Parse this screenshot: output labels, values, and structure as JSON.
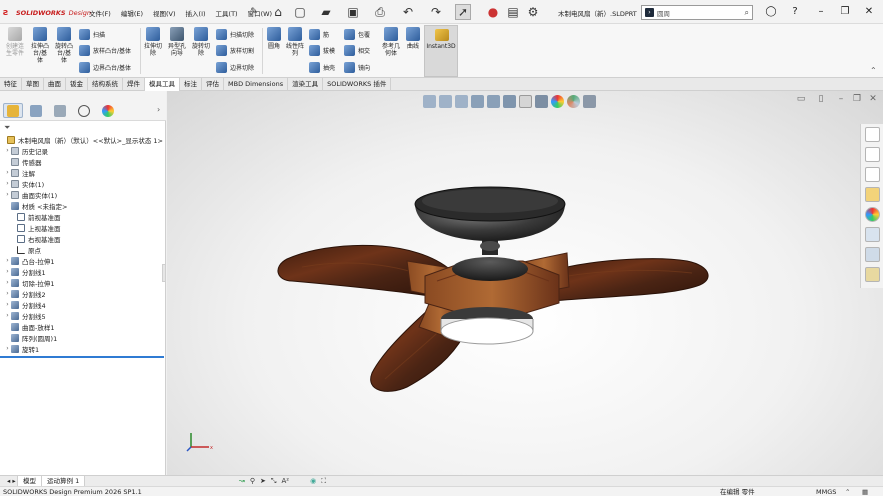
{
  "app": {
    "brand": "SOLIDWORKS",
    "brand_suffix": "Design",
    "doc_title": "木制电风扇（新）.SLDPRT",
    "search_text": "圆周"
  },
  "menu": [
    "文件(F)",
    "编辑(E)",
    "视图(V)",
    "插入(I)",
    "工具(T)",
    "窗口(W)"
  ],
  "ribbon": {
    "create_block": "创建连\n生零件",
    "extrude_boss": "拉伸凸\n台/基\n体",
    "revolve_boss": "旋转凸\n台/基\n体",
    "sweep": "扫描",
    "loft_boss": "放样凸台/基体",
    "boundary_boss": "边界凸台/基体",
    "extrude_cut": "拉伸切\n除",
    "hole_wizard": "异型孔\n向导",
    "revolve_cut": "旋转切\n除",
    "swept_cut": "扫描切除",
    "lofted_cut": "放样切割",
    "boundary_cut": "边界切除",
    "fillet": "圆角",
    "linear_pattern": "线性阵\n列",
    "rib": "筋",
    "draft": "拔模",
    "shell": "抽壳",
    "wrap": "包覆",
    "intersect": "相交",
    "mirror": "镜向",
    "ref_geometry": "参考几\n何体",
    "curves": "曲线",
    "instant3d": "Instant3D"
  },
  "tabs": [
    "特征",
    "草图",
    "曲面",
    "钣金",
    "结构系统",
    "焊件",
    "模具工具",
    "标注",
    "评估",
    "MBD Dimensions",
    "渲染工具",
    "SOLIDWORKS 插件"
  ],
  "active_tab": "模具工具",
  "tree": [
    {
      "label": "木制电风扇（新）（默认）<<默认>_显示状态 1>",
      "icon": "part",
      "exp": ""
    },
    {
      "label": "历史记录",
      "icon": "folder",
      "exp": "›"
    },
    {
      "label": "传感器",
      "icon": "folder",
      "exp": ""
    },
    {
      "label": "注解",
      "icon": "folder",
      "exp": "›"
    },
    {
      "label": "实体(1)",
      "icon": "folder",
      "exp": "›"
    },
    {
      "label": "曲面实体(1)",
      "icon": "folder",
      "exp": "›"
    },
    {
      "label": "材质 <未指定>",
      "icon": "material",
      "exp": ""
    },
    {
      "label": "前视基准面",
      "icon": "plane",
      "exp": ""
    },
    {
      "label": "上视基准面",
      "icon": "plane",
      "exp": ""
    },
    {
      "label": "右视基准面",
      "icon": "plane",
      "exp": ""
    },
    {
      "label": "原点",
      "icon": "origin",
      "exp": ""
    },
    {
      "label": "凸台-拉伸1",
      "icon": "feature",
      "exp": "›"
    },
    {
      "label": "分割线1",
      "icon": "feature",
      "exp": "›"
    },
    {
      "label": "切除-拉伸1",
      "icon": "feature",
      "exp": "›"
    },
    {
      "label": "分割线2",
      "icon": "feature",
      "exp": "›"
    },
    {
      "label": "分割线4",
      "icon": "feature",
      "exp": "›"
    },
    {
      "label": "分割线5",
      "icon": "feature",
      "exp": "›"
    },
    {
      "label": "曲面-放样1",
      "icon": "feature",
      "exp": ""
    },
    {
      "label": "阵列(圆周)1",
      "icon": "feature",
      "exp": ""
    },
    {
      "label": "旋转1",
      "icon": "feature",
      "exp": "›"
    }
  ],
  "bottom_tabs": [
    "模型",
    "运动算例 1"
  ],
  "status": {
    "left": "SOLIDWORKS Design Premium 2026 SP1.1",
    "editing": "在编辑 零件",
    "units": "MMGS"
  },
  "colors": {
    "wood_dark": "#4a2414",
    "wood_mid": "#7a3c1e",
    "wood_light": "#a6602e",
    "canopy": "#2e2e2e",
    "accent_blue": "#2f7bd3",
    "brand_red": "#c81e1e"
  }
}
